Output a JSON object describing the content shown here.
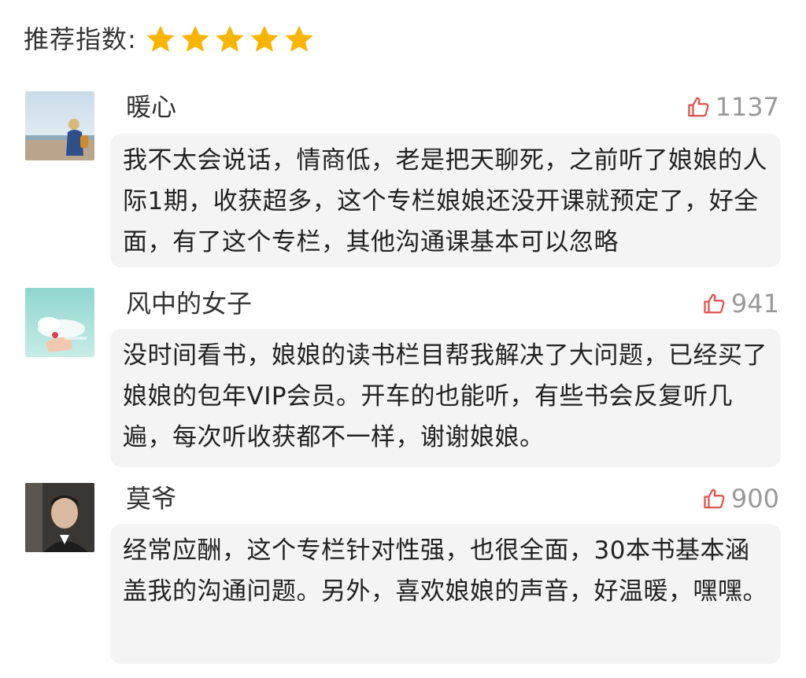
{
  "header": {
    "rating_label": "推荐指数:",
    "rating": {
      "value": 5,
      "max": 5
    },
    "star_color": "#F7B500"
  },
  "colors": {
    "like_icon": "#E0504B",
    "count_text": "#999999",
    "bubble_bg": "#F4F4F4"
  },
  "comments": [
    {
      "username": "暖心",
      "likes": "1137",
      "text": "我不太会说话，情商低，老是把天聊死，之前听了娘娘的人际1期，收获超多，这个专栏娘娘还没开课就预定了，好全面，有了这个专栏，其他沟通课基本可以忽略"
    },
    {
      "username": "风中的女子",
      "likes": "941",
      "text": "没时间看书，娘娘的读书栏目帮我解决了大问题，已经买了娘娘的包年VIP会员。开车的也能听，有些书会反复听几遍，每次听收获都不一样，谢谢娘娘。"
    },
    {
      "username": "莫爷",
      "likes": "900",
      "text": "经常应酬，这个专栏针对性强，也很全面，30本书基本涵盖我的沟通问题。另外，喜欢娘娘的声音，好温暖，嘿嘿。"
    }
  ]
}
